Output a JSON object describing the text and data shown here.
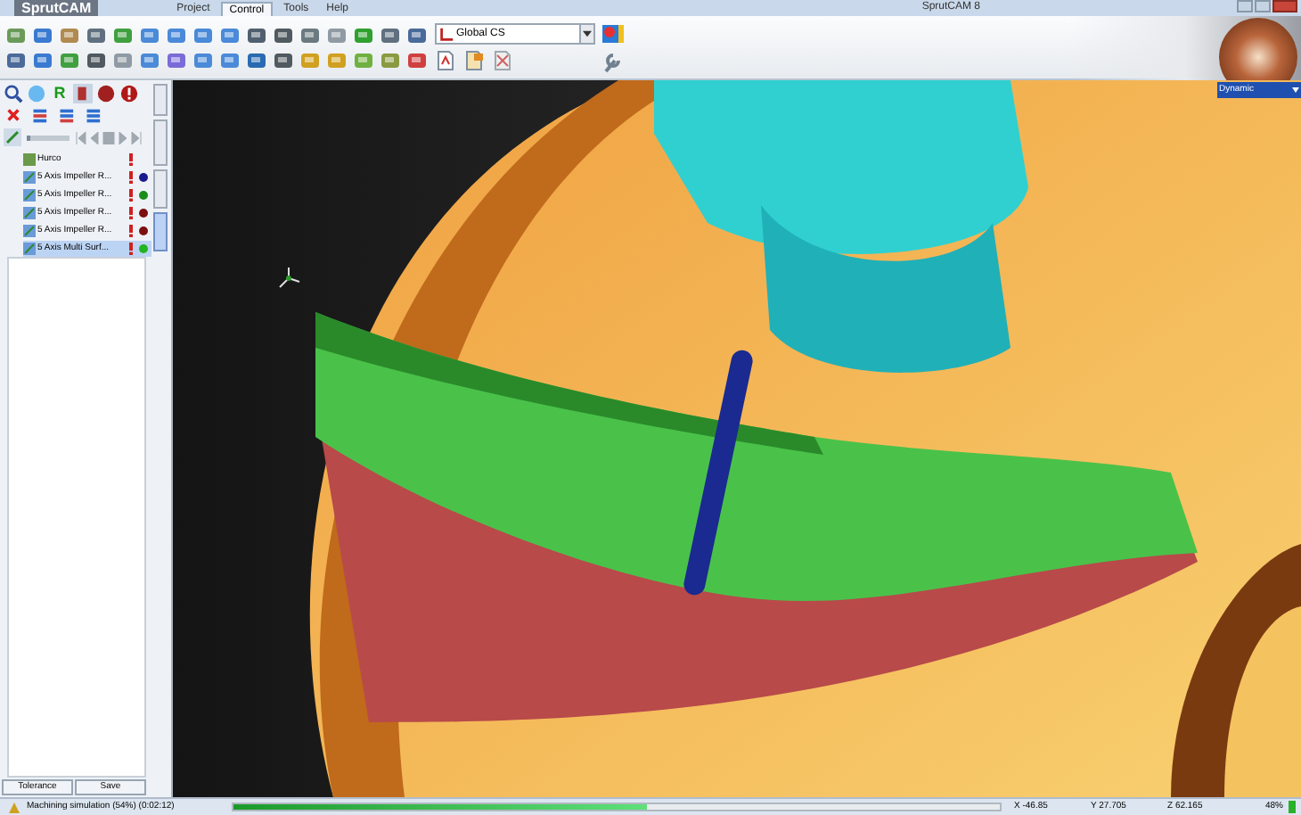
{
  "window": {
    "logo": "SprutCAM",
    "title": "SprutCAM 8"
  },
  "menu": [
    {
      "label": "Project",
      "selected": false
    },
    {
      "label": "Control",
      "selected": true
    },
    {
      "label": "Tools",
      "selected": false
    },
    {
      "label": "Help",
      "selected": false
    }
  ],
  "coordinate_system": {
    "value": "Global CS"
  },
  "panel_toolbar": {
    "r_button": "R",
    "speed": {
      "level": 0.1
    }
  },
  "side_tabs": [
    {
      "selected": false
    },
    {
      "selected": false
    },
    {
      "selected": false
    },
    {
      "selected": true
    }
  ],
  "tree": {
    "label": "Hurco",
    "children": [
      {
        "label": "5 Axis Impeller R...",
        "color": "#1a1a8c",
        "selected": false
      },
      {
        "label": "5 Axis Impeller R...",
        "color": "#1a8c1a",
        "selected": false
      },
      {
        "label": "5 Axis Impeller R...",
        "color": "#7a1010",
        "selected": false
      },
      {
        "label": "5 Axis Impeller R...",
        "color": "#7a1010",
        "selected": false
      },
      {
        "label": "5 Axis Multi Surf...",
        "color": "#22b422",
        "selected": true
      }
    ]
  },
  "panel_buttons": [
    "Tolerance",
    "Save"
  ],
  "view_mode": "Dynamic",
  "status_bar": {
    "message": "Machining simulation (54%) (0:02:12)",
    "progress": {
      "level": 0.54
    },
    "x": "X -46.85",
    "y": "Y 27.705",
    "z": "Z 62.165",
    "zoom": "48%"
  }
}
